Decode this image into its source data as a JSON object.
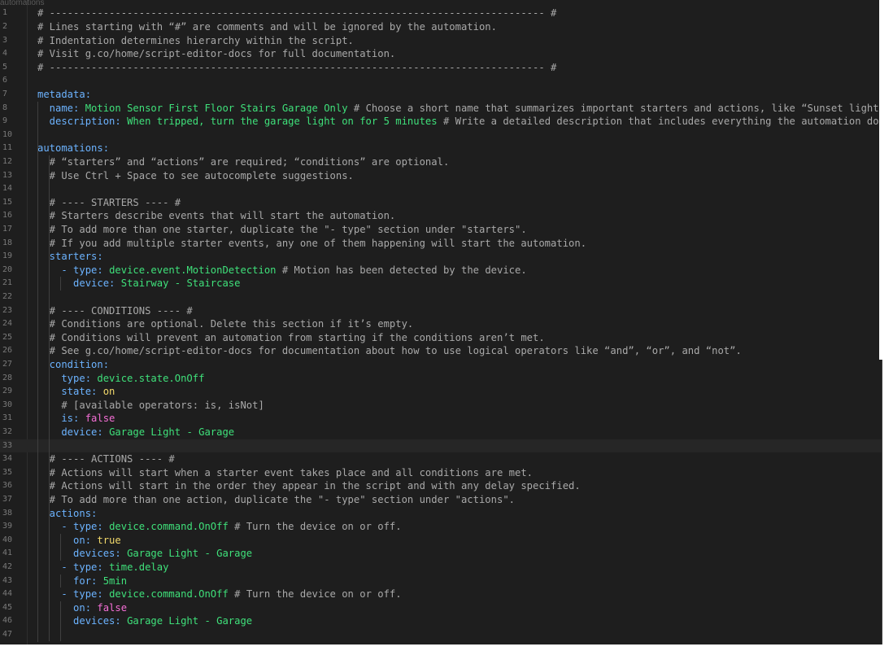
{
  "window": {
    "tab_label": "automations"
  },
  "colors": {
    "background": "#1e1e1e",
    "comment": "#a9a9a9",
    "key": "#6cb3ff",
    "value": "#3fe07a",
    "string_value": "#f2d96b",
    "boolean": "#f56fd6",
    "line_number": "#7a7a7a"
  },
  "editor": {
    "current_line": 33,
    "lines": [
      {
        "n": "1",
        "segs": [
          {
            "t": "# ----------------------------------------------------------------------------------- #",
            "c": "c"
          }
        ]
      },
      {
        "n": "2",
        "segs": [
          {
            "t": "# Lines starting with “#” are comments and will be ignored by the automation.",
            "c": "c"
          }
        ]
      },
      {
        "n": "3",
        "segs": [
          {
            "t": "# Indentation determines hierarchy within the script.",
            "c": "c"
          }
        ]
      },
      {
        "n": "4",
        "segs": [
          {
            "t": "# Visit g.co/home/script-editor-docs for full documentation.",
            "c": "c"
          }
        ]
      },
      {
        "n": "5",
        "segs": [
          {
            "t": "# ----------------------------------------------------------------------------------- #",
            "c": "c"
          }
        ]
      },
      {
        "n": "6",
        "segs": []
      },
      {
        "n": "7",
        "segs": [
          {
            "t": "metadata:",
            "c": "k"
          }
        ]
      },
      {
        "n": "8",
        "segs": [
          {
            "t": "  name: ",
            "c": "k"
          },
          {
            "t": "Motion Sensor First Floor Stairs Garage Only",
            "c": "v"
          },
          {
            "t": " # Choose a short name that summarizes important starters and actions, like “Sunset lights”.",
            "c": "c"
          }
        ]
      },
      {
        "n": "9",
        "segs": [
          {
            "t": "  description: ",
            "c": "k"
          },
          {
            "t": "When tripped, turn the garage light on for 5 minutes",
            "c": "v"
          },
          {
            "t": " # Write a detailed description that includes everything the automation does, i",
            "c": "c"
          }
        ]
      },
      {
        "n": "10",
        "segs": []
      },
      {
        "n": "11",
        "segs": [
          {
            "t": "automations:",
            "c": "k"
          }
        ]
      },
      {
        "n": "12",
        "segs": [
          {
            "t": "  # “starters” and “actions” are required; “conditions” are optional.",
            "c": "c"
          }
        ]
      },
      {
        "n": "13",
        "segs": [
          {
            "t": "  # Use Ctrl + Space to see autocomplete suggestions.",
            "c": "c"
          }
        ]
      },
      {
        "n": "14",
        "segs": []
      },
      {
        "n": "15",
        "segs": [
          {
            "t": "  # ---- STARTERS ---- #",
            "c": "c"
          }
        ]
      },
      {
        "n": "16",
        "segs": [
          {
            "t": "  # Starters describe events that will start the automation.",
            "c": "c"
          }
        ]
      },
      {
        "n": "17",
        "segs": [
          {
            "t": "  # To add more than one starter, duplicate the \"- type\" section under \"starters\".",
            "c": "c"
          }
        ]
      },
      {
        "n": "18",
        "segs": [
          {
            "t": "  # If you add multiple starter events, any one of them happening will start the automation.",
            "c": "c"
          }
        ]
      },
      {
        "n": "19",
        "segs": [
          {
            "t": "  starters:",
            "c": "k"
          }
        ]
      },
      {
        "n": "20",
        "segs": [
          {
            "t": "    - type: ",
            "c": "k"
          },
          {
            "t": "device.event.MotionDetection",
            "c": "v"
          },
          {
            "t": " # Motion has been detected by the device.",
            "c": "c"
          }
        ]
      },
      {
        "n": "21",
        "segs": [
          {
            "t": "      device: ",
            "c": "k"
          },
          {
            "t": "Stairway - Staircase",
            "c": "v"
          }
        ]
      },
      {
        "n": "22",
        "segs": []
      },
      {
        "n": "23",
        "segs": [
          {
            "t": "  # ---- CONDITIONS ---- #",
            "c": "c"
          }
        ]
      },
      {
        "n": "24",
        "segs": [
          {
            "t": "  # Conditions are optional. Delete this section if it’s empty.",
            "c": "c"
          }
        ]
      },
      {
        "n": "25",
        "segs": [
          {
            "t": "  # Conditions will prevent an automation from starting if the conditions aren’t met.",
            "c": "c"
          }
        ]
      },
      {
        "n": "26",
        "segs": [
          {
            "t": "  # See g.co/home/script-editor-docs for documentation about how to use logical operators like “and”, “or”, and “not”.",
            "c": "c"
          }
        ]
      },
      {
        "n": "27",
        "segs": [
          {
            "t": "  condition:",
            "c": "k"
          }
        ]
      },
      {
        "n": "28",
        "segs": [
          {
            "t": "    type: ",
            "c": "k"
          },
          {
            "t": "device.state.OnOff",
            "c": "v"
          }
        ]
      },
      {
        "n": "29",
        "segs": [
          {
            "t": "    state: ",
            "c": "k"
          },
          {
            "t": "on",
            "c": "s"
          }
        ]
      },
      {
        "n": "30",
        "segs": [
          {
            "t": "    # [available operators: is, isNot]",
            "c": "c"
          }
        ]
      },
      {
        "n": "31",
        "segs": [
          {
            "t": "    is: ",
            "c": "k"
          },
          {
            "t": "false",
            "c": "b"
          }
        ]
      },
      {
        "n": "32",
        "segs": [
          {
            "t": "    device: ",
            "c": "k"
          },
          {
            "t": "Garage Light - Garage",
            "c": "v"
          }
        ]
      },
      {
        "n": "33",
        "segs": []
      },
      {
        "n": "34",
        "segs": [
          {
            "t": "  # ---- ACTIONS ---- #",
            "c": "c"
          }
        ]
      },
      {
        "n": "35",
        "segs": [
          {
            "t": "  # Actions will start when a starter event takes place and all conditions are met.",
            "c": "c"
          }
        ]
      },
      {
        "n": "36",
        "segs": [
          {
            "t": "  # Actions will start in the order they appear in the script and with any delay specified.",
            "c": "c"
          }
        ]
      },
      {
        "n": "37",
        "segs": [
          {
            "t": "  # To add more than one action, duplicate the \"- type\" section under \"actions\".",
            "c": "c"
          }
        ]
      },
      {
        "n": "38",
        "segs": [
          {
            "t": "  actions:",
            "c": "k"
          }
        ]
      },
      {
        "n": "39",
        "segs": [
          {
            "t": "    - type: ",
            "c": "k"
          },
          {
            "t": "device.command.OnOff",
            "c": "v"
          },
          {
            "t": " # Turn the device on or off.",
            "c": "c"
          }
        ]
      },
      {
        "n": "40",
        "segs": [
          {
            "t": "      on: ",
            "c": "k"
          },
          {
            "t": "true",
            "c": "s"
          }
        ]
      },
      {
        "n": "41",
        "segs": [
          {
            "t": "      devices: ",
            "c": "k"
          },
          {
            "t": "Garage Light - Garage",
            "c": "v"
          }
        ]
      },
      {
        "n": "42",
        "segs": [
          {
            "t": "    - type: ",
            "c": "k"
          },
          {
            "t": "time.delay",
            "c": "v"
          }
        ]
      },
      {
        "n": "43",
        "segs": [
          {
            "t": "      for: ",
            "c": "k"
          },
          {
            "t": "5min",
            "c": "v"
          }
        ]
      },
      {
        "n": "44",
        "segs": [
          {
            "t": "    - type: ",
            "c": "k"
          },
          {
            "t": "device.command.OnOff",
            "c": "v"
          },
          {
            "t": " # Turn the device on or off.",
            "c": "c"
          }
        ]
      },
      {
        "n": "45",
        "segs": [
          {
            "t": "      on: ",
            "c": "k"
          },
          {
            "t": "false",
            "c": "b"
          }
        ]
      },
      {
        "n": "46",
        "segs": [
          {
            "t": "      devices: ",
            "c": "k"
          },
          {
            "t": "Garage Light - Garage",
            "c": "v"
          }
        ]
      },
      {
        "n": "47",
        "segs": []
      }
    ]
  }
}
